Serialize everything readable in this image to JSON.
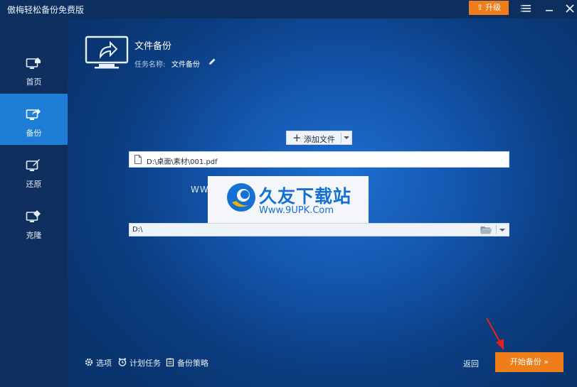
{
  "window": {
    "title": "傲梅轻松备份免费版",
    "upgrade_label": "升级"
  },
  "sidebar": {
    "items": [
      {
        "label": "首页",
        "icon": "home-monitor-icon",
        "active": false
      },
      {
        "label": "备份",
        "icon": "backup-monitor-icon",
        "active": true
      },
      {
        "label": "还原",
        "icon": "restore-monitor-icon",
        "active": false
      },
      {
        "label": "克隆",
        "icon": "clone-monitor-icon",
        "active": false
      }
    ]
  },
  "task": {
    "title": "文件备份",
    "name_label": "任务名称:",
    "name_value": "文件备份"
  },
  "source": {
    "add_file_label": "添加文件",
    "path": "D:\\桌面\\素材\\001.pdf"
  },
  "destination": {
    "path": "D:\\"
  },
  "watermark": {
    "left_text": "WWW.90",
    "brand": "久友下载站",
    "url": "Www.9UPK.Com"
  },
  "footer": {
    "options_label": "选项",
    "schedule_label": "计划任务",
    "policy_label": "备份策略",
    "back_label": "返回",
    "start_label": "开始备份 »"
  },
  "colors": {
    "accent_orange": "#ef7d1a",
    "active_blue": "#1e7ed6",
    "sidebar_bg": "#0f2f5e",
    "titlebar_bg": "#0d2f60"
  }
}
